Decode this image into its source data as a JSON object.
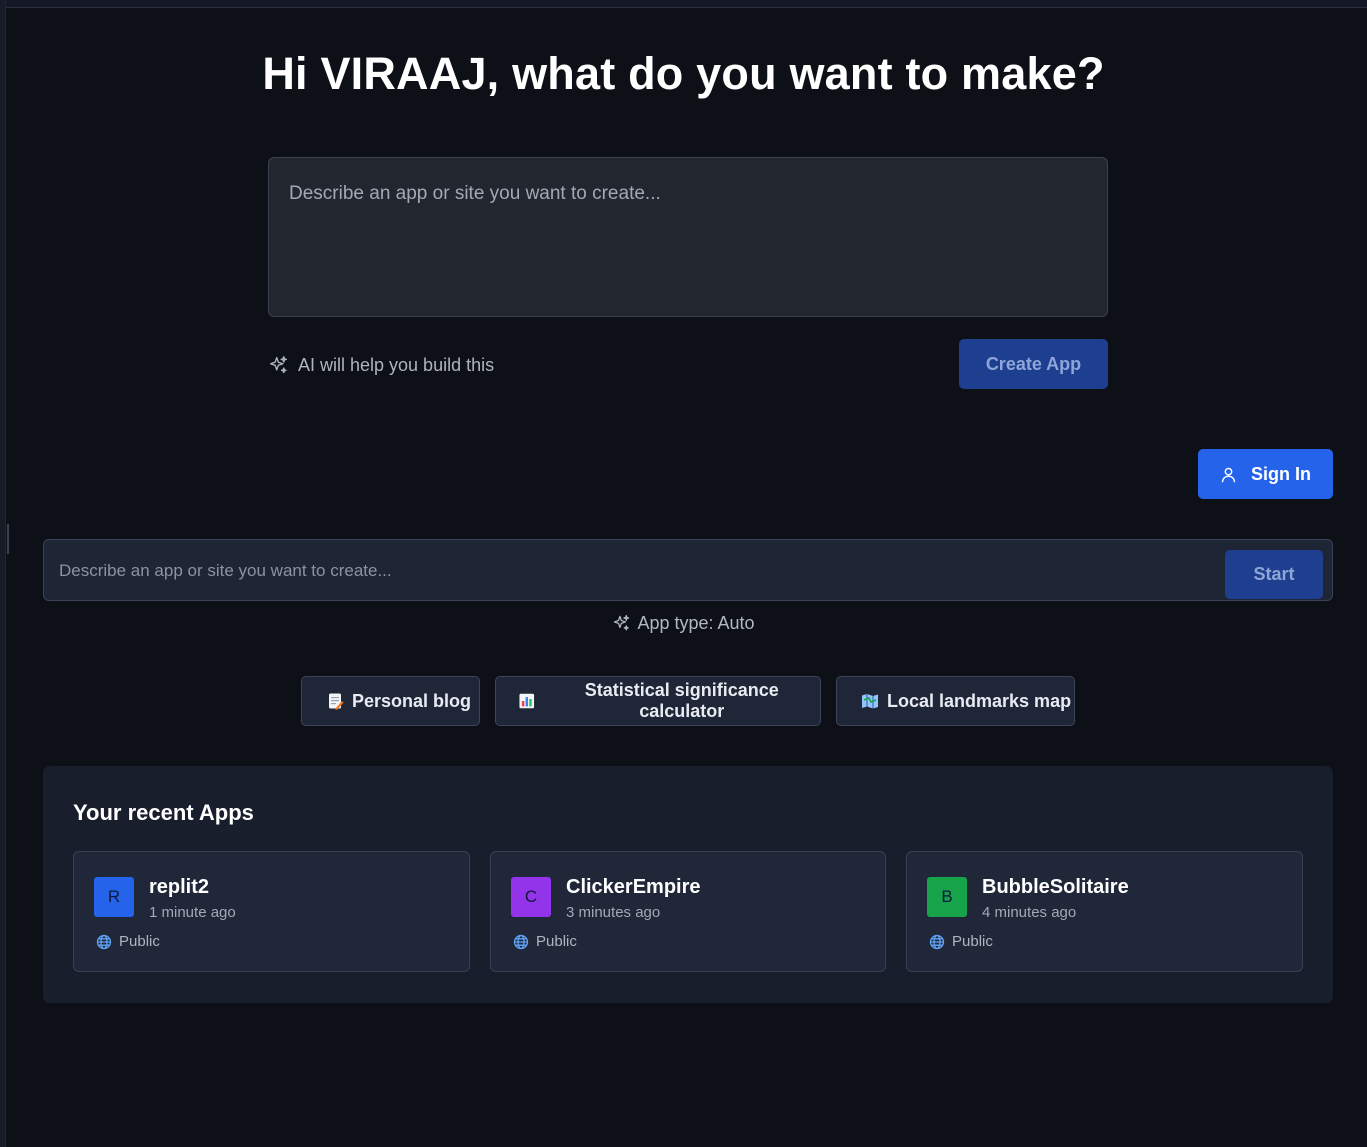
{
  "heading": "Hi VIRAAJ, what do you want to make?",
  "main_prompt": {
    "placeholder": "Describe an app or site you want to create..."
  },
  "ai_hint": "AI will help you build this",
  "create_button": "Create App",
  "sign_in_button": "Sign In",
  "quick_prompt": {
    "placeholder": "Describe an app or site you want to create...",
    "start_label": "Start"
  },
  "app_type": "App type: Auto",
  "suggestions": [
    {
      "label": "Personal blog",
      "icon": "memo-emoji-icon"
    },
    {
      "label": "Statistical significance calculator",
      "icon": "bar-chart-emoji-icon"
    },
    {
      "label": "Local landmarks map",
      "icon": "map-emoji-icon"
    }
  ],
  "recent": {
    "title": "Your recent Apps",
    "apps": [
      {
        "initial": "R",
        "name": "replit2",
        "time": "1 minute ago",
        "visibility": "Public",
        "color": "#2563eb"
      },
      {
        "initial": "C",
        "name": "ClickerEmpire",
        "time": "3 minutes ago",
        "visibility": "Public",
        "color": "#9333ea"
      },
      {
        "initial": "B",
        "name": "BubbleSolitaire",
        "time": "4 minutes ago",
        "visibility": "Public",
        "color": "#16a34a"
      }
    ]
  },
  "colors": {
    "background": "#0d1017",
    "primary": "#2563eb",
    "primary_disabled": "#1e3f8f",
    "panel": "#181e2b"
  }
}
